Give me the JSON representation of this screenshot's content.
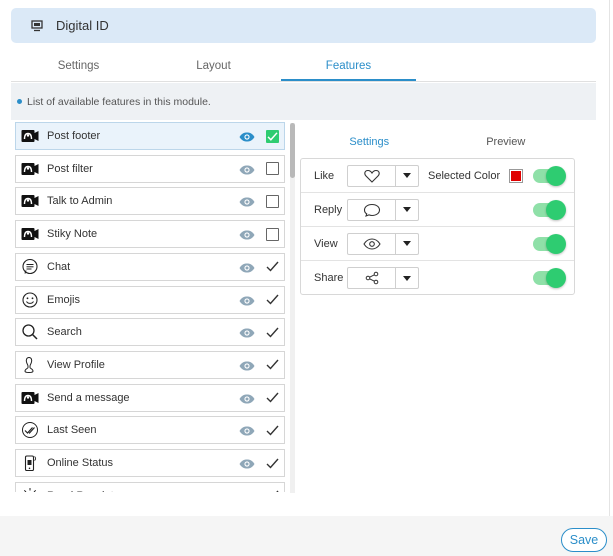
{
  "header": {
    "title": "Digital ID",
    "icon": "monitor-icon"
  },
  "tabs": [
    {
      "label": "Settings",
      "active": false
    },
    {
      "label": "Layout",
      "active": false
    },
    {
      "label": "Features",
      "active": true
    }
  ],
  "info": "List of available features in this module.",
  "features": [
    {
      "label": "Post footer",
      "icon": "camera-icon",
      "checked": true,
      "check_style": "box"
    },
    {
      "label": "Post filter",
      "icon": "camera-icon",
      "checked": false,
      "check_style": "box"
    },
    {
      "label": "Talk to Admin",
      "icon": "camera-icon",
      "checked": false,
      "check_style": "box"
    },
    {
      "label": "Stiky Note",
      "icon": "camera-icon",
      "checked": false,
      "check_style": "box"
    },
    {
      "label": "Chat",
      "icon": "chat-bubble-icon",
      "checked": true,
      "check_style": "tick"
    },
    {
      "label": "Emojis",
      "icon": "smiley-icon",
      "checked": true,
      "check_style": "tick"
    },
    {
      "label": "Search",
      "icon": "search-icon",
      "checked": true,
      "check_style": "tick"
    },
    {
      "label": "View Profile",
      "icon": "profile-icon",
      "checked": true,
      "check_style": "tick"
    },
    {
      "label": "Send a message",
      "icon": "camera-icon",
      "checked": true,
      "check_style": "tick"
    },
    {
      "label": "Last Seen",
      "icon": "double-check-icon",
      "checked": true,
      "check_style": "tick"
    },
    {
      "label": "Online Status",
      "icon": "phone-status-icon",
      "checked": true,
      "check_style": "tick"
    },
    {
      "label": "Read Receipts",
      "icon": "sun-icon",
      "checked": true,
      "check_style": "tick"
    }
  ],
  "right_tabs": [
    {
      "label": "Settings",
      "active": true
    },
    {
      "label": "Preview",
      "active": false
    }
  ],
  "rows": [
    {
      "label": "Like",
      "icon": "heart-icon",
      "selected_color_label": "Selected Color",
      "color": "#e00000",
      "enabled": true
    },
    {
      "label": "Reply",
      "icon": "speech-bubble-icon",
      "enabled": true
    },
    {
      "label": "View",
      "icon": "eye-icon",
      "enabled": true
    },
    {
      "label": "Share",
      "icon": "share-icon",
      "enabled": true
    }
  ],
  "save_label": "Save",
  "colors": {
    "accent": "#2b8ec9",
    "toggle_on": "#2ecc71",
    "header_bg": "#dbe9f7"
  }
}
